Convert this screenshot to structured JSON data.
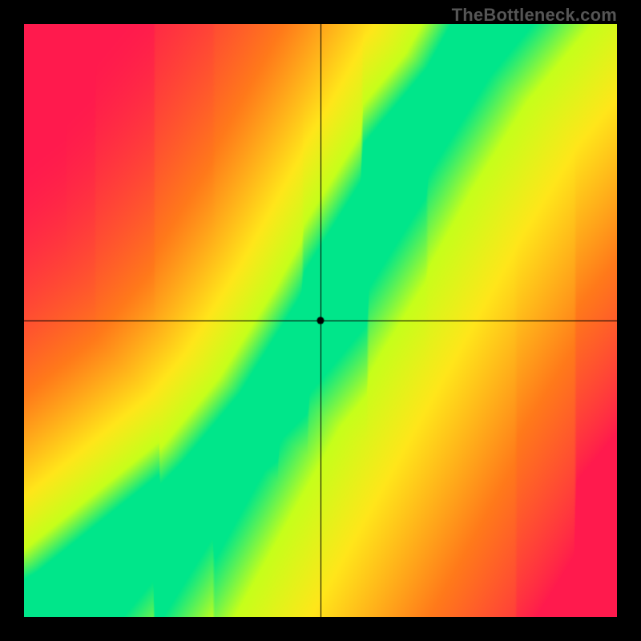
{
  "watermark": "TheBottleneck.com",
  "chart_data": {
    "type": "heatmap",
    "title": "",
    "xlabel": "",
    "ylabel": "",
    "xlim": [
      0,
      1
    ],
    "ylim": [
      0,
      1
    ],
    "crosshair": {
      "x": 0.5,
      "y": 0.5
    },
    "marker": {
      "x": 0.5,
      "y": 0.5
    },
    "optimal_curve": {
      "description": "ridge of best match (green band center)",
      "points": [
        {
          "x": 0.0,
          "y": 0.0
        },
        {
          "x": 0.05,
          "y": 0.04
        },
        {
          "x": 0.1,
          "y": 0.07
        },
        {
          "x": 0.15,
          "y": 0.1
        },
        {
          "x": 0.2,
          "y": 0.14
        },
        {
          "x": 0.25,
          "y": 0.18
        },
        {
          "x": 0.3,
          "y": 0.23
        },
        {
          "x": 0.35,
          "y": 0.29
        },
        {
          "x": 0.4,
          "y": 0.35
        },
        {
          "x": 0.45,
          "y": 0.43
        },
        {
          "x": 0.5,
          "y": 0.51
        },
        {
          "x": 0.55,
          "y": 0.6
        },
        {
          "x": 0.6,
          "y": 0.69
        },
        {
          "x": 0.65,
          "y": 0.78
        },
        {
          "x": 0.7,
          "y": 0.86
        },
        {
          "x": 0.75,
          "y": 0.94
        },
        {
          "x": 0.8,
          "y": 1.0
        }
      ]
    },
    "band_half_width": 0.045,
    "colorscale": [
      {
        "t": 0.0,
        "color": "#ff1a4d"
      },
      {
        "t": 0.4,
        "color": "#ff7a1a"
      },
      {
        "t": 0.7,
        "color": "#ffe61a"
      },
      {
        "t": 0.88,
        "color": "#c6ff1a"
      },
      {
        "t": 1.0,
        "color": "#00e68a"
      }
    ],
    "corner_values": {
      "top_left": 0.0,
      "top_right": 0.7,
      "bottom_left": 0.1,
      "bottom_right": 0.0
    }
  }
}
